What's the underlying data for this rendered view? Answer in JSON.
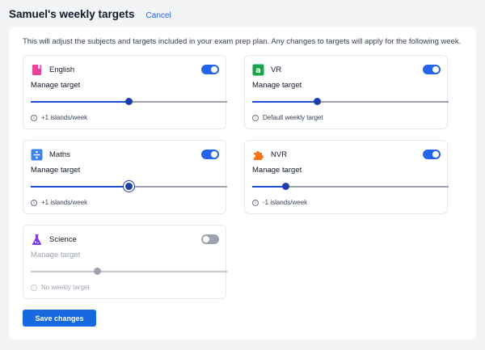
{
  "header": {
    "title": "Samuel's weekly targets",
    "cancel_label": "Cancel"
  },
  "intro": "This will adjust the subjects and targets included in your exam prep plan. Any changes to targets will apply for the following week.",
  "subjects": [
    {
      "name": "English",
      "icon": "book-icon",
      "icon_color": "#e8459a",
      "enabled": true,
      "manage_label": "Manage target",
      "slider_value": 0.5,
      "note": "+1 islands/week"
    },
    {
      "name": "VR",
      "icon": "letter-a-icon",
      "icon_color": "#16a34a",
      "enabled": true,
      "manage_label": "Manage target",
      "slider_value": 0.33,
      "note": "Default weekly target"
    },
    {
      "name": "Maths",
      "icon": "divide-icon",
      "icon_color": "#3b82f6",
      "enabled": true,
      "manage_label": "Manage target",
      "slider_value": 0.5,
      "note": "+1 islands/week"
    },
    {
      "name": "NVR",
      "icon": "puzzle-icon",
      "icon_color": "#f97316",
      "enabled": true,
      "manage_label": "Manage target",
      "slider_value": 0.17,
      "note": "-1 islands/week"
    },
    {
      "name": "Science",
      "icon": "flask-icon",
      "icon_color": "#7c3aed",
      "enabled": false,
      "manage_label": "Manage target",
      "slider_value": 0.34,
      "note": "No weekly target"
    }
  ],
  "save_label": "Save changes"
}
